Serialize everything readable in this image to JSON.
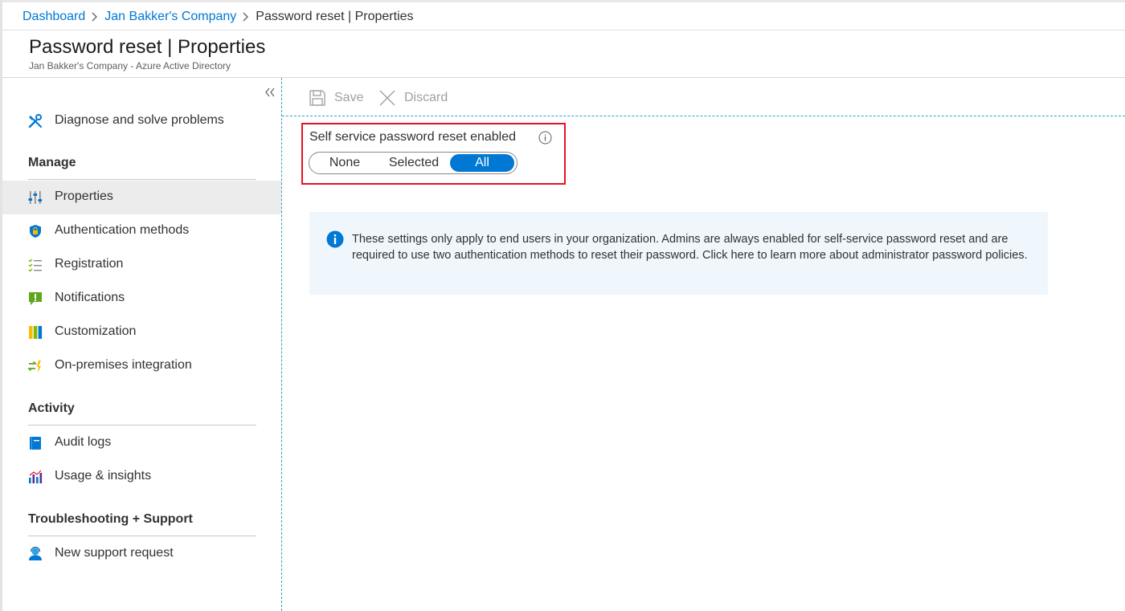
{
  "breadcrumb": {
    "items": [
      "Dashboard",
      "Jan Bakker's Company",
      "Password reset | Properties"
    ]
  },
  "header": {
    "title": "Password reset | Properties",
    "subtitle": "Jan Bakker's Company - Azure Active Directory"
  },
  "sidebar": {
    "top_items": [
      {
        "label": "Diagnose and solve problems",
        "icon": "wrench-icon"
      }
    ],
    "sections": [
      {
        "heading": "Manage",
        "items": [
          {
            "label": "Properties",
            "icon": "sliders-icon",
            "active": true
          },
          {
            "label": "Authentication methods",
            "icon": "shield-lock-icon"
          },
          {
            "label": "Registration",
            "icon": "checklist-icon"
          },
          {
            "label": "Notifications",
            "icon": "notification-icon"
          },
          {
            "label": "Customization",
            "icon": "customization-icon"
          },
          {
            "label": "On-premises integration",
            "icon": "sync-icon"
          }
        ]
      },
      {
        "heading": "Activity",
        "items": [
          {
            "label": "Audit logs",
            "icon": "book-icon"
          },
          {
            "label": "Usage & insights",
            "icon": "chart-icon"
          }
        ]
      },
      {
        "heading": "Troubleshooting + Support",
        "items": [
          {
            "label": "New support request",
            "icon": "support-person-icon"
          }
        ]
      }
    ]
  },
  "toolbar": {
    "save_label": "Save",
    "discard_label": "Discard"
  },
  "sspr": {
    "label": "Self service password reset enabled",
    "options": [
      "None",
      "Selected",
      "All"
    ],
    "selected": "All"
  },
  "info_banner": {
    "text": "These settings only apply to end users in your organization. Admins are always enabled for self-service password reset and are required to use two authentication methods to reset their password. Click here to learn more about administrator password policies."
  },
  "colors": {
    "accent": "#0078d4",
    "highlight_border": "#e81123",
    "banner_bg": "#eff6fc"
  }
}
